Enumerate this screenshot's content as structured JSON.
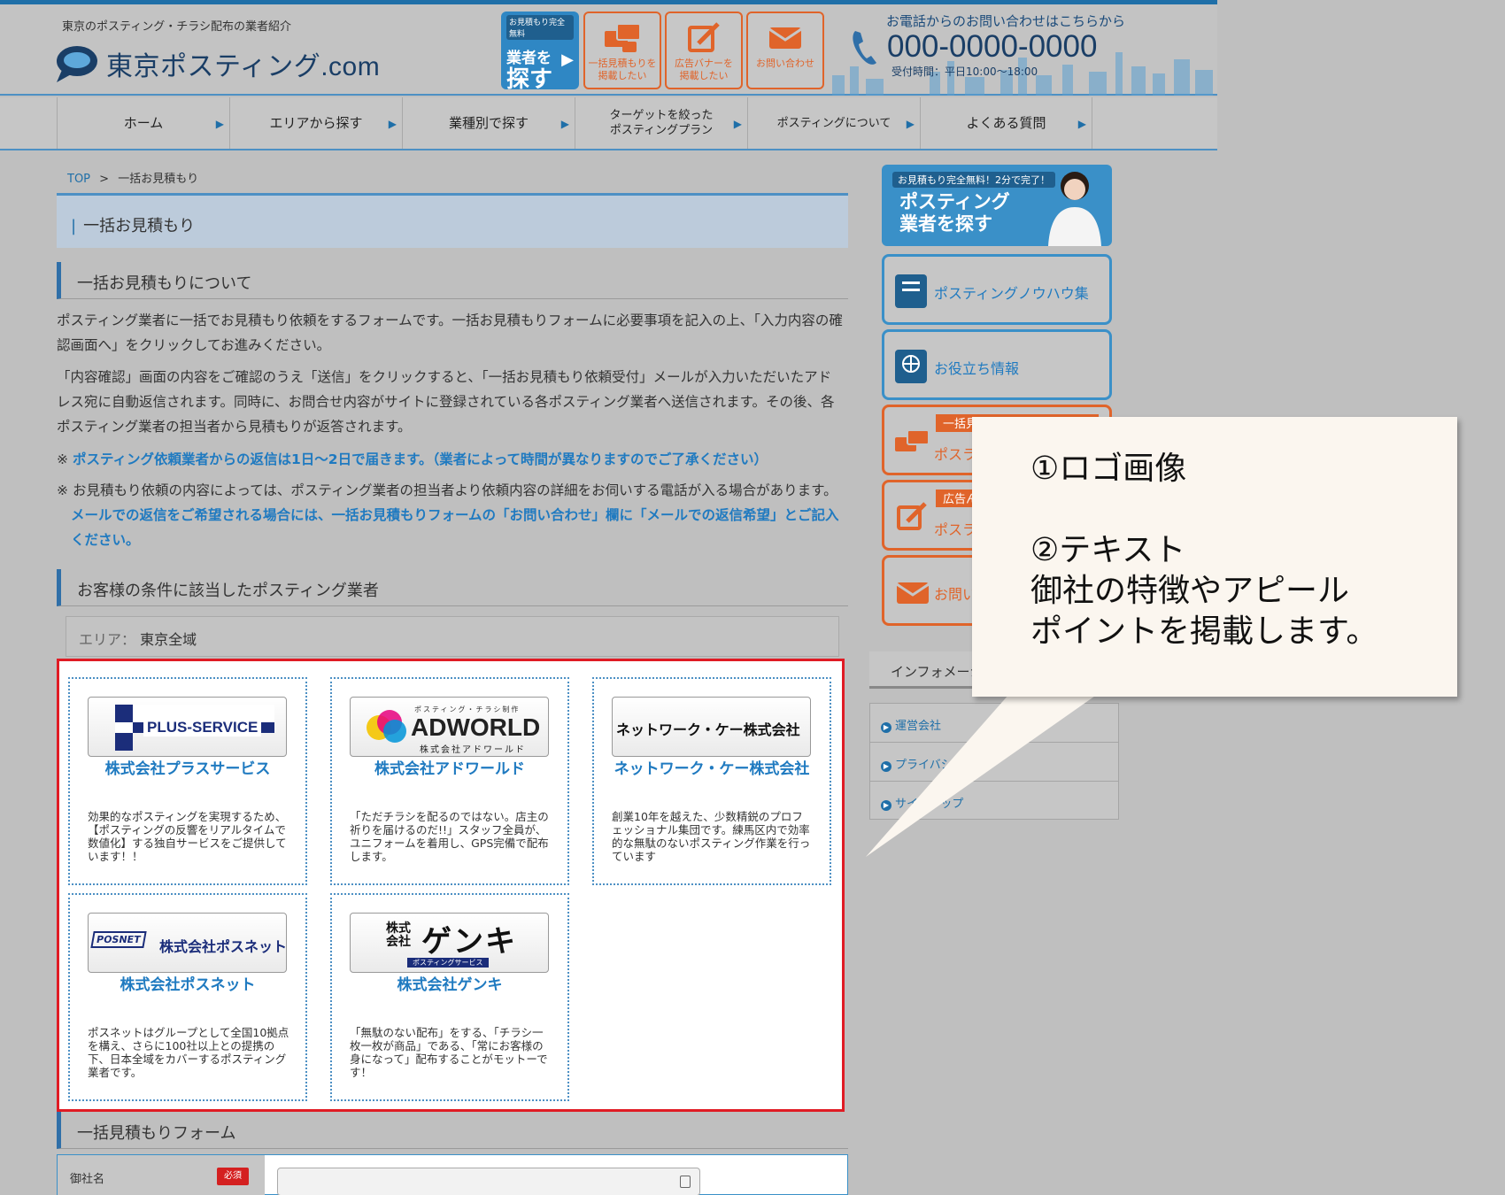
{
  "header": {
    "tagline": "東京のポスティング・チラシ配布の業者紹介",
    "logo_text": "東京ポスティング.com",
    "find_button": {
      "tag": "お見積もり完全無料",
      "line1": "業者を",
      "line2": "探す"
    },
    "buttons": [
      {
        "label": "一括見積もりを\n掲載したい",
        "icon": "quote-icon"
      },
      {
        "label": "広告バナーを\n掲載したい",
        "icon": "edit-icon"
      },
      {
        "label": "お問い合わせ",
        "icon": "mail-icon"
      }
    ],
    "phone_caption": "お電話からのお問い合わせはこちらから",
    "phone_number": "000-0000-0000",
    "phone_hours": "受付時間：平日10:00〜18:00"
  },
  "nav": [
    "ホーム",
    "エリアから探す",
    "業種別で探す",
    "ターゲットを絞った\nポスティングプラン",
    "ポスティングについて",
    "よくある質問"
  ],
  "breadcrumb": {
    "top": "TOP",
    "sep": ">",
    "current": "一括お見積もり"
  },
  "page_title": "一括お見積もり",
  "about": {
    "heading": "一括お見積もりについて",
    "p1": "ポスティング業者に一括でお見積もり依頼をするフォームです。一括お見積もりフォームに必要事項を記入の上、「入力内容の確認画面へ」をクリックしてお進みください。",
    "p2": "「内容確認」画面の内容をご確認のうえ「送信」をクリックすると、「一括お見積もり依頼受付」メールが入力いただいたアドレス宛に自動返信されます。同時に、お問合せ内容がサイトに登録されている各ポスティング業者へ送信されます。その後、各ポスティング業者の担当者から見積もりが返答されます。",
    "note1_mark": "※",
    "note1": "ポスティング依頼業者からの返信は1日〜2日で届きます。（業者によって時間が異なりますのでご了承ください）",
    "note2_mark": "※",
    "note2_plain": "お見積もり依頼の内容によっては、ポスティング業者の担当者より依頼内容の詳細をお伺いする電話が入る場合があります。",
    "note2_blue": "メールでの返信をご希望される場合には、一括お見積もりフォームの「お問い合わせ」欄に「メールでの返信希望」とご記入ください。"
  },
  "vendors_section": {
    "heading": "お客様の条件に該当したポスティング業者",
    "area_label": "エリア：",
    "area_value": "東京全域"
  },
  "vendors": [
    {
      "logo_text": "PLUS-SERVICE",
      "name": "株式会社プラスサービス",
      "desc": "効果的なポスティングを実現するため、【ポスティングの反響をリアルタイムで数値化】する独自サービスをご提供しています！！"
    },
    {
      "logo_text": "ADWORLD",
      "logo_sub_top": "ポスティング・チラシ制作",
      "logo_sub": "株式会社アドワールド",
      "name": "株式会社アドワールド",
      "desc": "「ただチラシを配るのではない。店主の祈りを届けるのだ!!」スタッフ全員が、ユニフォームを着用し、GPS完備で配布します。"
    },
    {
      "logo_text": "ネットワーク・ケー株式会社",
      "name": "ネットワーク・ケー株式会社",
      "desc": "創業10年を越えた、少数精鋭のプロフェッショナル集団です。練馬区内で効率的な無駄のないポスティング作業を行っています"
    },
    {
      "logo_text": "株式会社ポスネット",
      "logo_badge": "POSNET",
      "name": "株式会社ポスネット",
      "desc": "ポスネットはグループとして全国10拠点を構え、さらに100社以上との提携の下、日本全域をカバーするポスティング業者です。"
    },
    {
      "logo_text": "ゲンキ",
      "logo_small": "株式\n会社",
      "logo_sub": "ポスティングサービス",
      "name": "株式会社ゲンキ",
      "desc": "「無駄のない配布」をする、「チラシ一枚一枚が商品」である、「常にお客様の身になって」配布することがモットーです！"
    }
  ],
  "sidebar": {
    "banner_tag": "お見積もり完全無料！2分で完了！",
    "banner_text": "ポスティング\n業者を探す",
    "items": [
      {
        "label": "ポスティングノウハウ集"
      },
      {
        "label": "お役立ち情報"
      },
      {
        "tag": "一括見",
        "label": "ポスラ"
      },
      {
        "tag": "広告ん",
        "label": "ポスラ"
      },
      {
        "label": "お問い"
      }
    ],
    "info_heading": "インフォメーシ",
    "info_items": [
      "運営会社",
      "プライバシー",
      "サイト   ップ"
    ]
  },
  "form": {
    "heading": "一括見積もりフォーム",
    "company_label": "御社名",
    "required": "必須"
  },
  "callout": {
    "line1": "①ロゴ画像",
    "line2": "②テキスト",
    "line3": "御社の特徴やアピール",
    "line4": "ポイントを掲載します。"
  },
  "colors": {
    "brand_blue": "#1f6fa8",
    "accent_orange": "#e0642a",
    "highlight_red": "#e01b24"
  }
}
